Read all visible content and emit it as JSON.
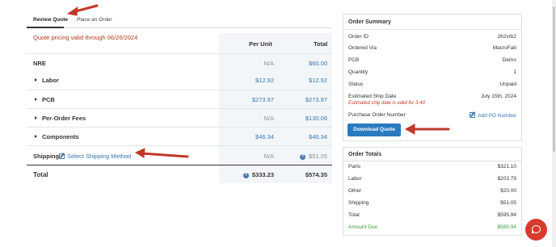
{
  "tabs": [
    {
      "label": "Review Quote",
      "active": true
    },
    {
      "label": "Place an Order",
      "active": false
    }
  ],
  "validity_notice": "Quote pricing valid through 06/26/2024",
  "quote_table": {
    "headers": {
      "per_unit": "Per Unit",
      "total": "Total"
    },
    "rows": [
      {
        "label": "NRE",
        "per_unit": "N/A",
        "total": "$60.00",
        "expandable": false
      },
      {
        "label": "Labor",
        "per_unit": "$12.92",
        "total": "$12.92",
        "expandable": true
      },
      {
        "label": "PCB",
        "per_unit": "$273.97",
        "total": "$273.97",
        "expandable": true
      },
      {
        "label": "Per-Order Fees",
        "per_unit": "N/A",
        "total": "$130.06",
        "expandable": true
      },
      {
        "label": "Components",
        "per_unit": "$46.34",
        "total": "$46.34",
        "expandable": true
      }
    ],
    "shipping": {
      "label": "Shipping",
      "link": "Select Shipping Method",
      "per_unit": "N/A",
      "total": "$51.05"
    },
    "total": {
      "label": "Total",
      "per_unit": "$333.23",
      "total": "$574.35"
    }
  },
  "order_summary": {
    "title": "Order Summary",
    "items": [
      {
        "key": "Order ID",
        "value": "262vrb2"
      },
      {
        "key": "Ordered Via",
        "value": "MacroFab"
      },
      {
        "key": "PCB",
        "value": "Demo"
      },
      {
        "key": "Quantity",
        "value": "1"
      },
      {
        "key": "Status",
        "value": "Unpaid"
      },
      {
        "key": "Estimated Ship Date",
        "value": "July 15th, 2024"
      }
    ],
    "ship_date_note": "Estimated ship date is valid for 3-40",
    "po_label": "Purchase Order Number",
    "po_link": "Add PO Number",
    "download_button": "Download Quote"
  },
  "order_totals": {
    "title": "Order Totals",
    "items": [
      {
        "key": "Parts",
        "value": "$321.10"
      },
      {
        "key": "Labor",
        "value": "$203.79"
      },
      {
        "key": "Other",
        "value": "$20.00"
      },
      {
        "key": "Shipping",
        "value": "$51.05"
      },
      {
        "key": "Total",
        "value": "$595.94"
      }
    ],
    "amount_due": {
      "key": "Amount Due",
      "value": "$595.94"
    }
  },
  "colors": {
    "accent_blue": "#3578b5",
    "button_blue": "#2a7abf",
    "warning_red": "#b33a1a",
    "success_green": "#3a9b3a",
    "annotation_red": "#c0392b",
    "chat_red": "#d63b2d"
  },
  "icons": [
    "caret-right-icon",
    "edit-icon",
    "info-icon",
    "chat-icon"
  ]
}
